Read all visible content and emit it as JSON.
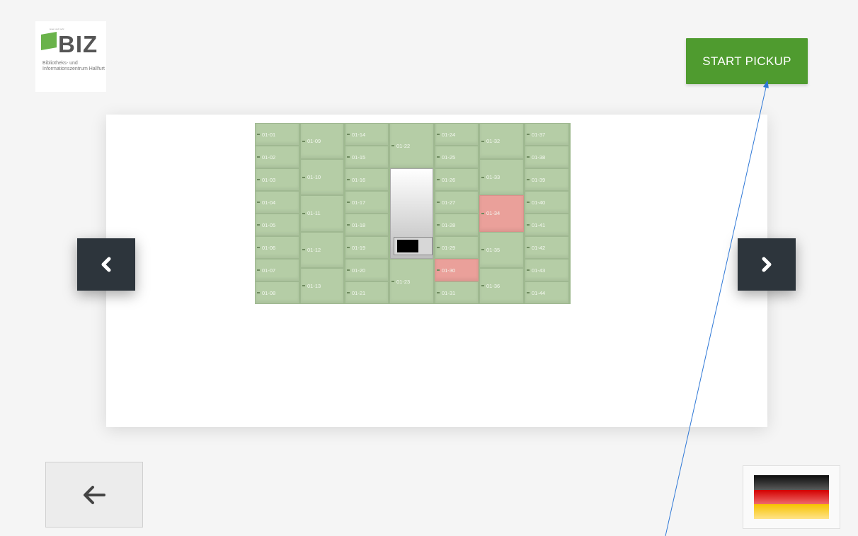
{
  "logo": {
    "name": "BIZ",
    "tagline": "lesen und mehr",
    "subtitle": "Bibliotheks- und Informationszentrum Hallfurt"
  },
  "start_button": {
    "label": "START PICKUP",
    "color": "#4f9b2f"
  },
  "navigation": {
    "prev_icon": "chevron-left-icon",
    "next_icon": "chevron-right-icon",
    "back_icon": "arrow-left-icon"
  },
  "language": {
    "flag": "germany-flag-icon",
    "colors": [
      "#1a1a1a",
      "#dd0000",
      "#ffce00"
    ]
  },
  "locker_map": {
    "available_color": "#b5cda6",
    "occupied_color": "#eaa09a",
    "lockers": [
      {
        "id": "01-01",
        "occupied": false
      },
      {
        "id": "01-02",
        "occupied": false
      },
      {
        "id": "01-03",
        "occupied": false
      },
      {
        "id": "01-04",
        "occupied": false
      },
      {
        "id": "01-05",
        "occupied": false
      },
      {
        "id": "01-06",
        "occupied": false
      },
      {
        "id": "01-07",
        "occupied": false
      },
      {
        "id": "01-08",
        "occupied": false
      },
      {
        "id": "01-09",
        "occupied": false
      },
      {
        "id": "01-10",
        "occupied": false
      },
      {
        "id": "01-11",
        "occupied": false
      },
      {
        "id": "01-12",
        "occupied": false
      },
      {
        "id": "01-13",
        "occupied": false
      },
      {
        "id": "01-14",
        "occupied": false
      },
      {
        "id": "01-15",
        "occupied": false
      },
      {
        "id": "01-16",
        "occupied": false
      },
      {
        "id": "01-17",
        "occupied": false
      },
      {
        "id": "01-18",
        "occupied": false
      },
      {
        "id": "01-19",
        "occupied": false
      },
      {
        "id": "01-20",
        "occupied": false
      },
      {
        "id": "01-21",
        "occupied": false
      },
      {
        "id": "01-22",
        "occupied": false
      },
      {
        "id": "01-23",
        "occupied": false
      },
      {
        "id": "01-24",
        "occupied": false
      },
      {
        "id": "01-25",
        "occupied": false
      },
      {
        "id": "01-26",
        "occupied": false
      },
      {
        "id": "01-27",
        "occupied": false
      },
      {
        "id": "01-28",
        "occupied": false
      },
      {
        "id": "01-29",
        "occupied": false
      },
      {
        "id": "01-30",
        "occupied": true
      },
      {
        "id": "01-31",
        "occupied": false
      },
      {
        "id": "01-32",
        "occupied": false
      },
      {
        "id": "01-33",
        "occupied": false
      },
      {
        "id": "01-34",
        "occupied": true
      },
      {
        "id": "01-35",
        "occupied": false
      },
      {
        "id": "01-36",
        "occupied": false
      },
      {
        "id": "01-37",
        "occupied": false
      },
      {
        "id": "01-38",
        "occupied": false
      },
      {
        "id": "01-39",
        "occupied": false
      },
      {
        "id": "01-40",
        "occupied": false
      },
      {
        "id": "01-41",
        "occupied": false
      },
      {
        "id": "01-42",
        "occupied": false
      },
      {
        "id": "01-43",
        "occupied": false
      },
      {
        "id": "01-44",
        "occupied": false
      }
    ]
  }
}
